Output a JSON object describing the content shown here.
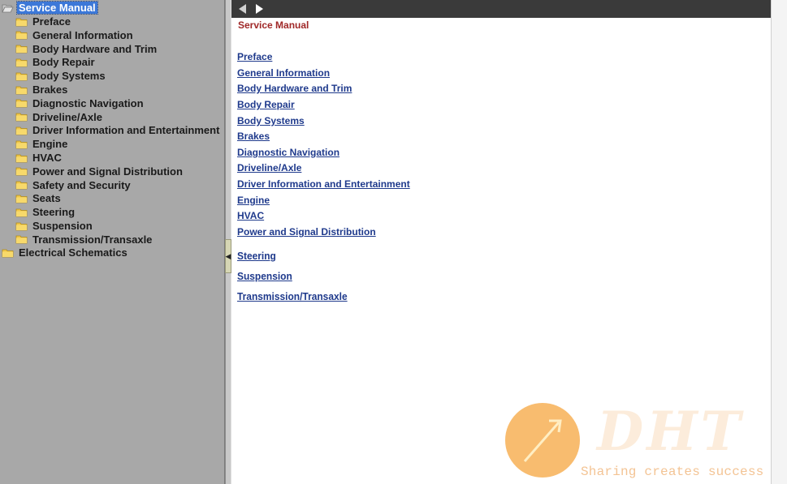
{
  "tree": {
    "root": "Service Manual",
    "items": [
      {
        "label": "Preface"
      },
      {
        "label": "General Information"
      },
      {
        "label": "Body Hardware and Trim"
      },
      {
        "label": "Body Repair"
      },
      {
        "label": "Body Systems"
      },
      {
        "label": "Brakes"
      },
      {
        "label": "Diagnostic Navigation"
      },
      {
        "label": "Driveline/Axle"
      },
      {
        "label": "Driver Information and Entertainment"
      },
      {
        "label": "Engine"
      },
      {
        "label": "HVAC"
      },
      {
        "label": "Power and Signal Distribution"
      },
      {
        "label": "Safety and Security"
      },
      {
        "label": "Seats"
      },
      {
        "label": "Steering"
      },
      {
        "label": "Suspension"
      },
      {
        "label": "Transmission/Transaxle"
      }
    ],
    "sibling": "Electrical Schematics"
  },
  "toolbar": {
    "back_icon": "back-arrow-icon",
    "forward_icon": "forward-arrow-icon"
  },
  "content": {
    "title": "Service Manual",
    "links": [
      {
        "label": "Preface"
      },
      {
        "label": "General Information"
      },
      {
        "label": "Body Hardware and Trim"
      },
      {
        "label": "Body Repair"
      },
      {
        "label": "Body Systems"
      },
      {
        "label": "Brakes"
      },
      {
        "label": "Diagnostic Navigation"
      },
      {
        "label": "Driveline/Axle"
      },
      {
        "label": "Driver Information and Entertainment"
      },
      {
        "label": "Engine"
      },
      {
        "label": "HVAC"
      },
      {
        "label": "Power and Signal Distribution"
      },
      {
        "label": "Steering"
      },
      {
        "label": "Suspension"
      },
      {
        "label": "Transmission/Transaxle"
      }
    ]
  },
  "watermark": {
    "logo": "DHT",
    "tagline": "Sharing creates success"
  },
  "colors": {
    "tree_bg": "#a8a8a8",
    "selection": "#3c78d8",
    "title_red": "#a02828",
    "link_blue": "#1f3a8c",
    "toolbar": "#3a3a3a"
  }
}
